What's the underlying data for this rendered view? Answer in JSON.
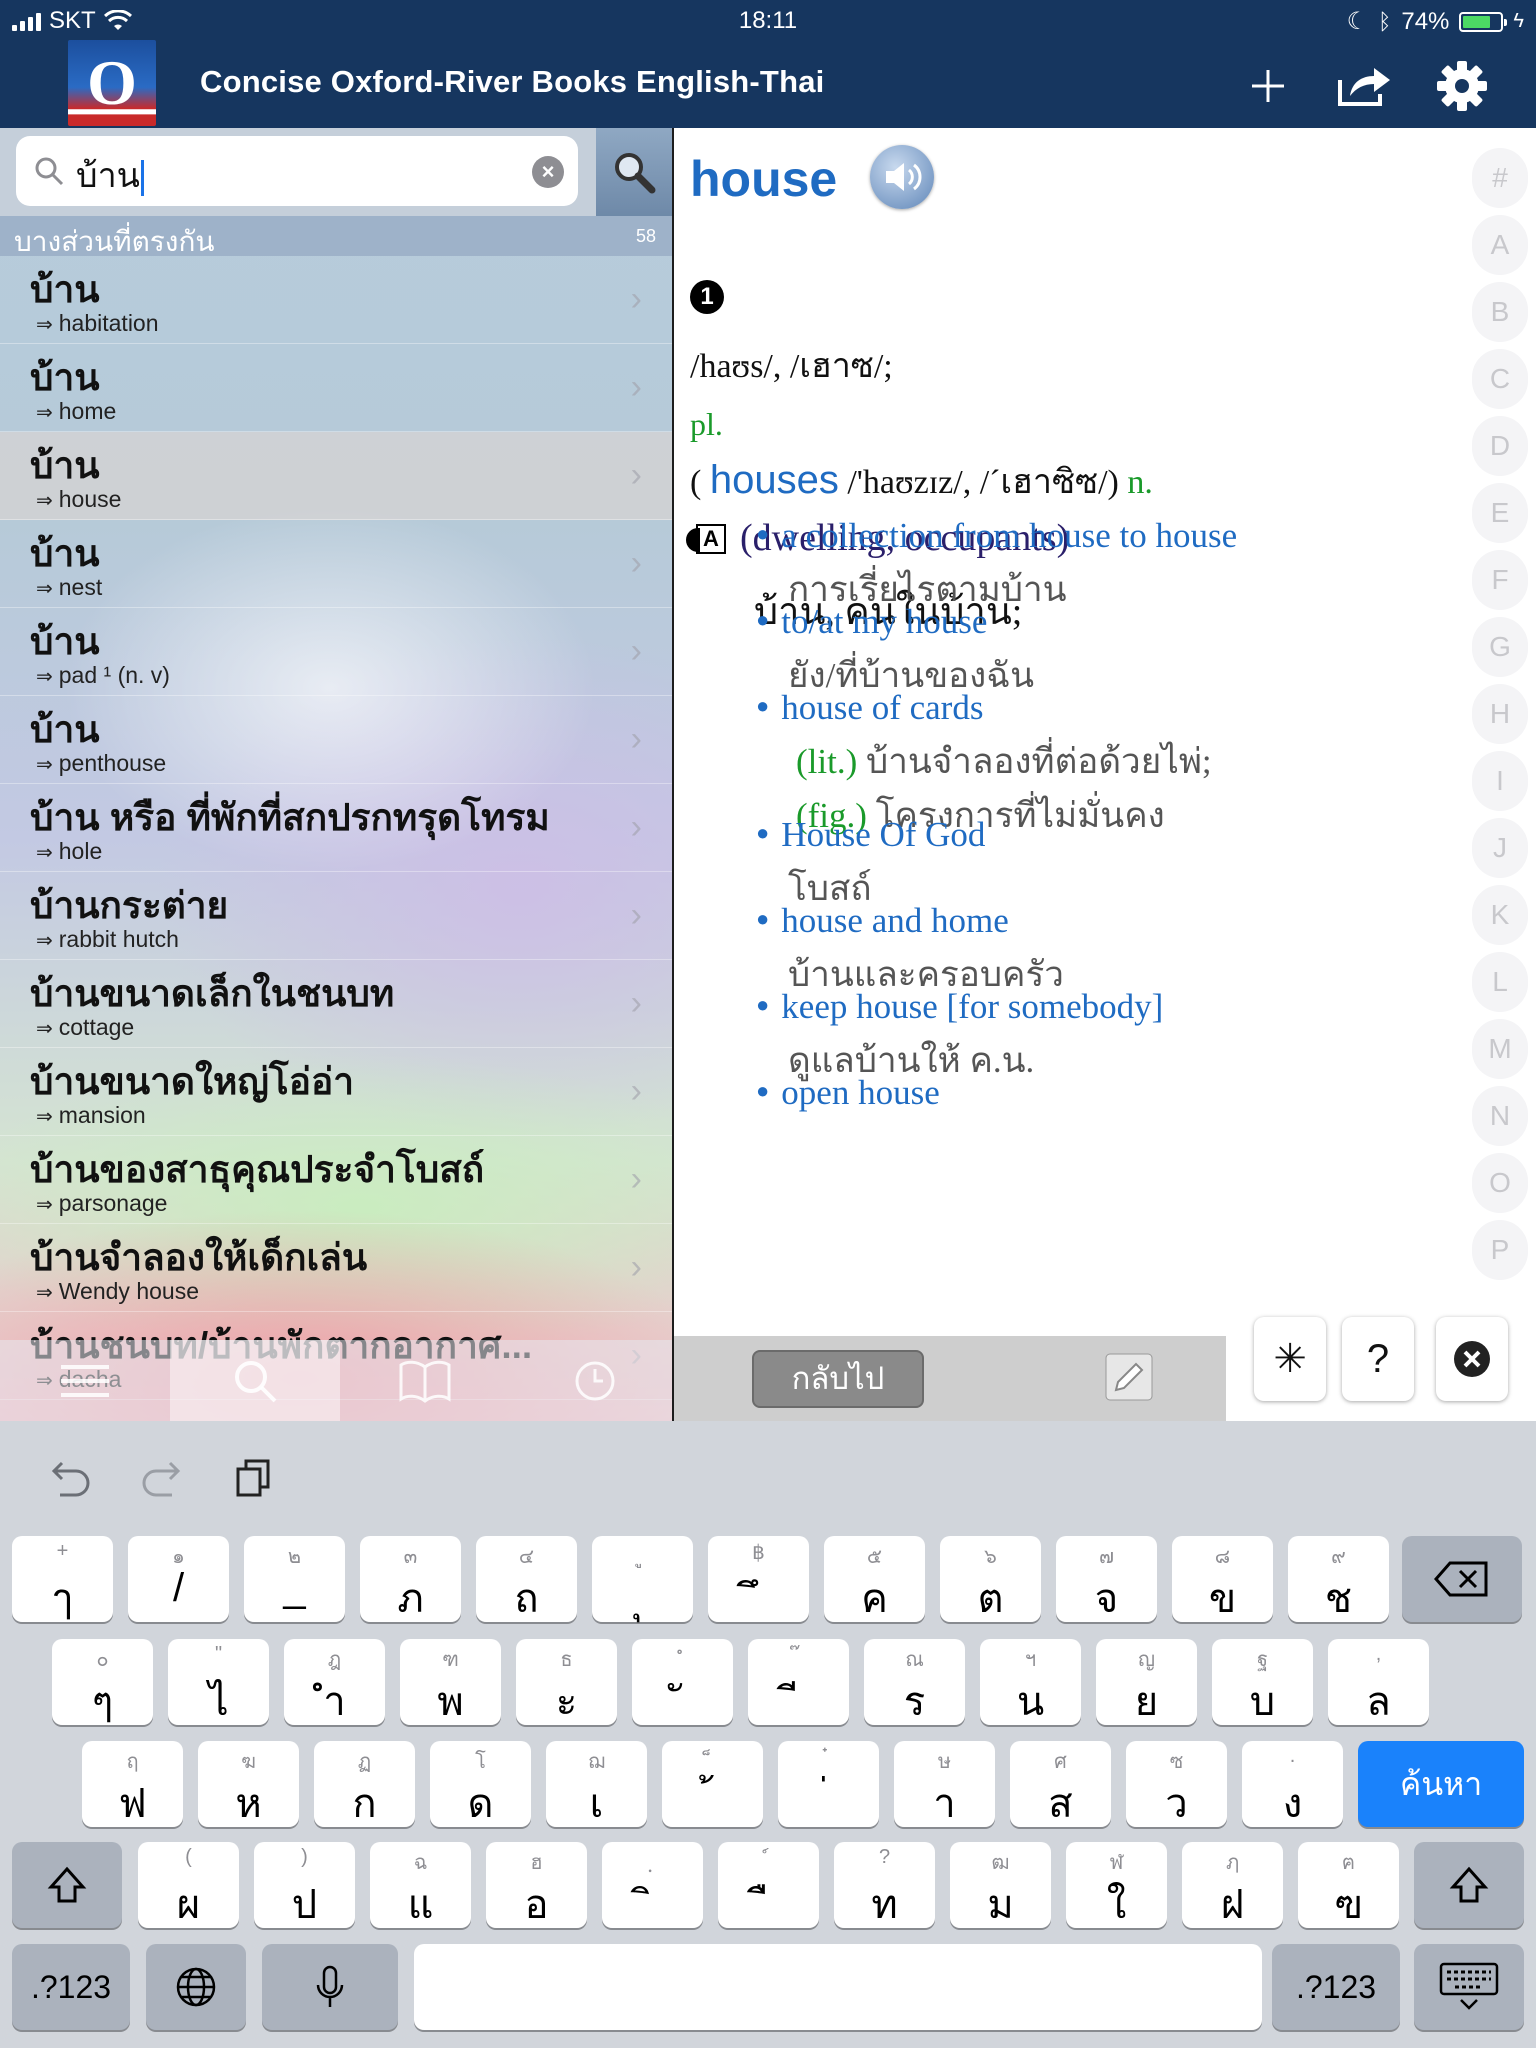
{
  "status_bar": {
    "carrier": "SKT",
    "time": "18:11",
    "battery": "74%",
    "battery_level": 0.74
  },
  "nav": {
    "logo_letter": "O",
    "title": "Concise Oxford-River Books English-Thai"
  },
  "search": {
    "query": "บ้าน",
    "section_title": "บางส่วนที่ตรงกัน",
    "match_count": "58"
  },
  "results": [
    {
      "word": "บ้าน",
      "english": "habitation",
      "selected": false
    },
    {
      "word": "บ้าน",
      "english": "home",
      "selected": false
    },
    {
      "word": "บ้าน",
      "english": "house",
      "selected": true
    },
    {
      "word": "บ้าน",
      "english": "nest",
      "selected": false
    },
    {
      "word": "บ้าน",
      "english": "pad ¹ (n. v)",
      "selected": false
    },
    {
      "word": "บ้าน",
      "english": "penthouse",
      "selected": false
    },
    {
      "word": "บ้าน หรือ ที่พักที่สกปรกทรุดโทรม",
      "english": "hole",
      "selected": false
    },
    {
      "word": "บ้านกระต่าย",
      "english": "rabbit hutch",
      "selected": false
    },
    {
      "word": "บ้านขนาดเล็กในชนบท",
      "english": "cottage",
      "selected": false
    },
    {
      "word": "บ้านขนาดใหญ่โอ่อ่า",
      "english": "mansion",
      "selected": false
    },
    {
      "word": "บ้านของสาธุคุณประจำโบสถ์",
      "english": "parsonage",
      "selected": false
    },
    {
      "word": "บ้านจำลองให้เด็กเล่น",
      "english": "Wendy house",
      "selected": false
    },
    {
      "word": "บ้านชนบท/บ้านพักตากอากาศ...",
      "english": "dacha",
      "selected": false
    }
  ],
  "arrow_glyph": "⇒",
  "entry": {
    "headword": "house",
    "homograph": "1",
    "pronunciation": "/haʊs/, /เฮาซ/;",
    "plural_label": "pl.",
    "plural_open": "(",
    "plural_word": "houses",
    "plural_pron": "/'haʊzɪz/, /ˊเฮาซิซ/)",
    "pos": "n.",
    "sense_letter": "A",
    "sense_gloss": "(dwelling, occupants)",
    "sense_thai": "บ้าน, คนในบ้าน;",
    "examples": [
      {
        "en": "a collection from house to house",
        "th": "การเรี่ยไรตามบ้าน"
      },
      {
        "en": "to/at my house",
        "th": "ยัง/ที่บ้านของฉัน"
      },
      {
        "en": "house of cards",
        "lit_label": "(lit.)",
        "lit": "บ้านจำลองที่ต่อด้วยไพ่;",
        "fig_label": "(fig.)",
        "fig": "โครงการที่ไม่มั่นคง"
      },
      {
        "en": "House Of God",
        "th": "โบสถ์"
      },
      {
        "en": "house and home",
        "th": "บ้านและครอบครัว"
      },
      {
        "en": "keep house [for somebody]",
        "th": "ดูแลบ้านให้ ค.น."
      },
      {
        "en": "open house",
        "th": ""
      }
    ]
  },
  "alphabet": [
    "#",
    "A",
    "B",
    "C",
    "D",
    "E",
    "F",
    "G",
    "H",
    "I",
    "J",
    "K",
    "L",
    "M",
    "N",
    "O",
    "P"
  ],
  "overlay": {
    "back_label": "กลับไป"
  },
  "wildcards": {
    "star": "✳",
    "question": "?"
  },
  "keyboard": {
    "row1": [
      [
        "+",
        "ๅ"
      ],
      [
        "๑",
        "/"
      ],
      [
        "๒",
        "_"
      ],
      [
        "๓",
        "ภ"
      ],
      [
        "๔",
        "ถ"
      ],
      [
        "ู",
        "ุ"
      ],
      [
        "฿",
        "ึ"
      ],
      [
        "๕",
        "ค"
      ],
      [
        "๖",
        "ต"
      ],
      [
        "๗",
        "จ"
      ],
      [
        "๘",
        "ข"
      ],
      [
        "๙",
        "ช"
      ]
    ],
    "row2": [
      [
        "๐",
        "ๆ"
      ],
      [
        "\"",
        "ไ"
      ],
      [
        "ฎ",
        "ำ"
      ],
      [
        "ฑ",
        "พ"
      ],
      [
        "ธ",
        "ะ"
      ],
      [
        "ํ",
        "ั"
      ],
      [
        "๊",
        "ี"
      ],
      [
        "ณ",
        "ร"
      ],
      [
        "ฯ",
        "น"
      ],
      [
        "ญ",
        "ย"
      ],
      [
        "ฐ",
        "บ"
      ],
      [
        ",",
        "ล"
      ]
    ],
    "row3": [
      [
        "ฤ",
        "ฟ"
      ],
      [
        "ฆ",
        "ห"
      ],
      [
        "ฏ",
        "ก"
      ],
      [
        "โ",
        "ด"
      ],
      [
        "ฌ",
        "เ"
      ],
      [
        "็",
        "้"
      ],
      [
        "๋",
        "่"
      ],
      [
        "ษ",
        "า"
      ],
      [
        "ศ",
        "ส"
      ],
      [
        "ซ",
        "ว"
      ],
      [
        ".",
        "ง"
      ]
    ],
    "row4": [
      [
        "(",
        "ผ"
      ],
      [
        ")",
        "ป"
      ],
      [
        "ฉ",
        "แ"
      ],
      [
        "ฮ",
        "อ"
      ],
      [
        "ฺ",
        "ิ"
      ],
      [
        "์",
        "ื"
      ],
      [
        "?",
        "ท"
      ],
      [
        "ฒ",
        "ม"
      ],
      [
        "ฬ",
        "ใ"
      ],
      [
        "ฦ",
        "ฝ"
      ],
      [
        "ฅ",
        "ฃ"
      ]
    ],
    "search_label": "ค้นหา",
    "numbers_label": ".?123"
  }
}
